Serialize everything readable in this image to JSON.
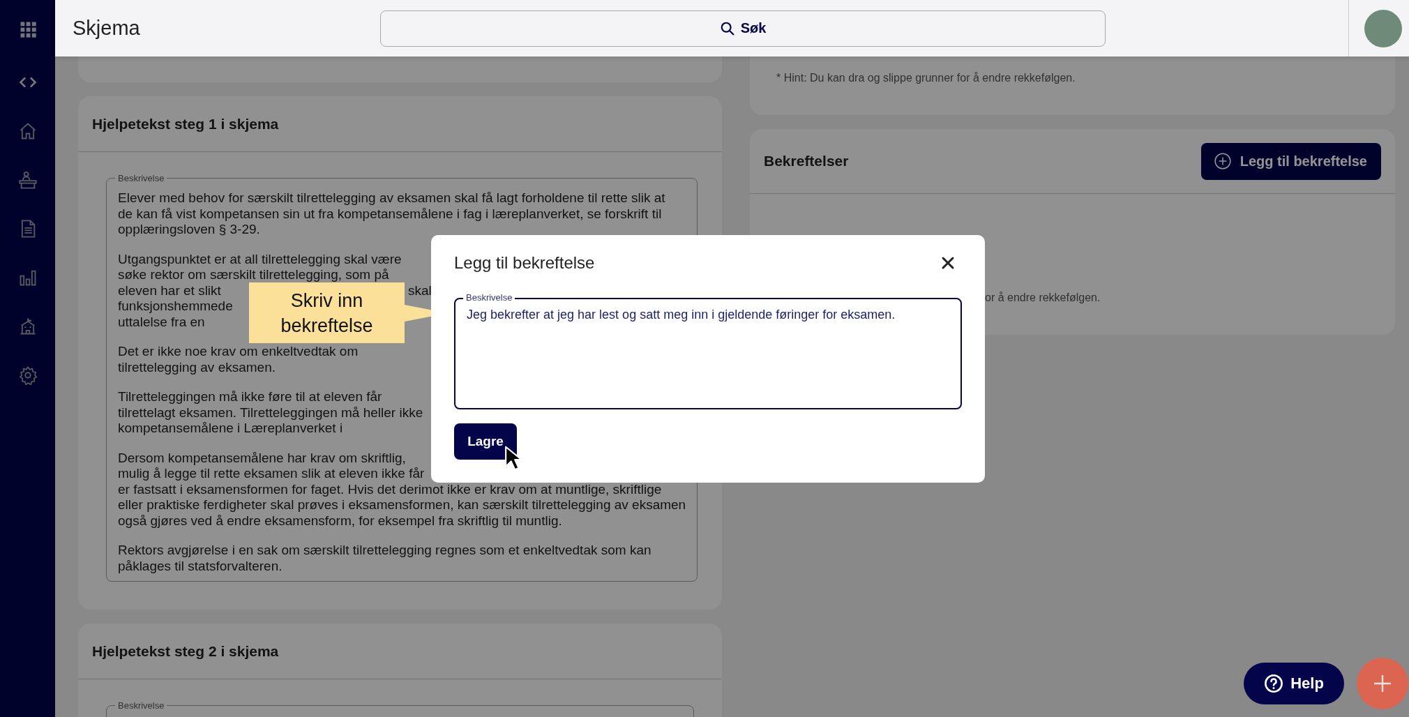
{
  "app": {
    "title": "Skjema"
  },
  "search": {
    "placeholder": "Søk"
  },
  "help_cards": [
    {
      "title": "Hjelpetekst steg 1 i skjema",
      "field_label": "Beskrivelse",
      "paragraphs": [
        [
          [
            "Elever med behov for særskilt tilrettelegging av eksamen skal få lagt forholdene til rette slik at"
          ],
          [
            "de kan få vist kompetansen sin ut fra kompetansemålene i fag i læreplanverket, se forskrift til"
          ],
          [
            "opplæringsloven § 3-29."
          ]
        ],
        [
          [
            "Utgangspunktet er at all tilrettelegging skal være"
          ],
          [
            "søke rektor om særskilt tilrettelegging, som på"
          ],
          [
            "eleven har et slikt",
            "skal"
          ],
          [
            "funksjonshemmede"
          ],
          [
            "uttalelse fra en"
          ]
        ],
        [
          [
            "Det er ikke noe krav om enkeltvedtak om"
          ],
          [
            "tilrettelegging av eksamen."
          ]
        ],
        [
          [
            "Tilretteleggingen må ikke føre til at eleven får"
          ],
          [
            "tilrettelagt eksamen. Tilretteleggingen må heller ikke"
          ],
          [
            "kompetansemålene i Læreplanverket i"
          ]
        ],
        [
          [
            "Dersom kompetansemålene har krav om skriftlig,"
          ],
          [
            "mulig å legge til rette eksamen slik at eleven ikke får"
          ],
          [
            "er fastsatt i eksamensformen for faget. Hvis det derimot ikke er krav om at muntlige, skriftlige"
          ],
          [
            "eller praktiske ferdigheter skal prøves i eksamensformen, kan særskilt tilrettelegging av eksamen"
          ],
          [
            "også gjøres ved å endre eksamensform, for eksempel fra skriftlig til muntlig."
          ]
        ],
        [
          [
            "Rektors avgjørelse i en sak om særskilt tilrettelegging regnes som et enkeltvedtak som kan"
          ],
          [
            "påklages til statsforvalteren."
          ]
        ]
      ]
    },
    {
      "title": "Hjelpetekst steg 2 i skjema",
      "field_label": "Beskrivelse"
    }
  ],
  "hint_card": {
    "hint": "* Hint: Du kan dra og slippe grunner for å endre rekkefølgen."
  },
  "confirmations": {
    "title": "Bekreftelser",
    "add_button": "Legg til bekreftelse",
    "hint_fragment": "or å endre rekkefølgen."
  },
  "modal": {
    "title": "Legg til bekreftelse",
    "field_label": "Beskrivelse",
    "value": "Jeg bekrefter at jeg har lest og satt meg inn i gjeldende føringer for eksamen.",
    "save_button": "Lagre"
  },
  "callout": {
    "text": "Skriv inn bekreftelse"
  },
  "help_button": {
    "label": "Help"
  }
}
